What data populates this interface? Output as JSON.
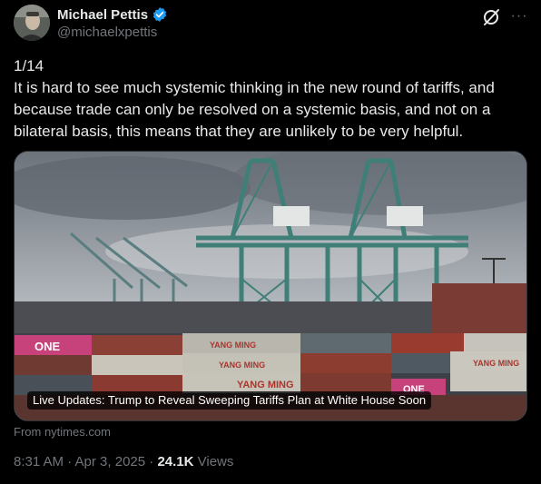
{
  "author": {
    "display_name": "Michael Pettis",
    "handle": "@michaelxpettis",
    "avatar_icon": "avatar-photo",
    "verified_icon": "verified-badge-icon"
  },
  "actions": {
    "grok_icon": "grok-icon",
    "more_label": "···"
  },
  "tweet": {
    "text": "1/14\nIt is hard to see much systemic thinking in the new round of tariffs, and because trade can only be resolved on a systemic basis, and not on a bilateral basis, this means that they are unlikely to be very helpful."
  },
  "card": {
    "headline": "Live Updates: Trump to Reveal Sweeping Tariffs Plan at White House Soon",
    "source": "From nytimes.com",
    "container_labels": [
      "ONE",
      "YANG MING",
      "YANG MING",
      "YANG MING",
      "ONE",
      "YANG MING"
    ]
  },
  "meta": {
    "timestamp": "8:31 AM · Apr 3, 2025 · ",
    "views_count": "24.1K",
    "views_label": " Views"
  },
  "colors": {
    "background": "#000000",
    "text": "#e7e9ea",
    "muted": "#71767b",
    "verified": "#1d9bf0"
  }
}
